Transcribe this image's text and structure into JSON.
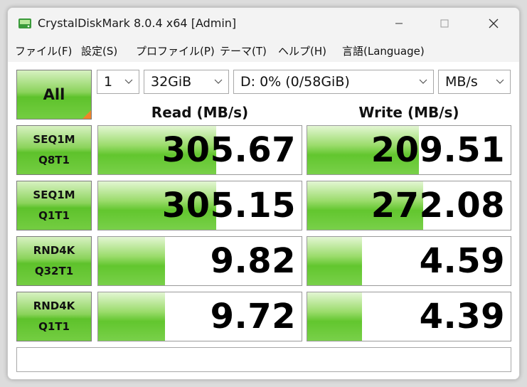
{
  "window": {
    "title": "CrystalDiskMark 8.0.4 x64 [Admin]",
    "app_icon": "disk-icon",
    "controls": [
      "minimize-icon",
      "maximize-icon",
      "close-icon"
    ]
  },
  "menu": {
    "items": [
      "ファイル(F)",
      "設定(S)",
      "プロファイル(P)",
      "テーマ(T)",
      "ヘルプ(H)",
      "言語(Language)"
    ]
  },
  "toolbar": {
    "all_label": "All",
    "count": "1",
    "size": "32GiB",
    "drive": "D: 0% (0/58GiB)",
    "unit": "MB/s"
  },
  "headers": {
    "read": "Read (MB/s)",
    "write": "Write (MB/s)"
  },
  "tests": [
    {
      "line1": "SEQ1M",
      "line2": "Q8T1",
      "read": "305.67",
      "write": "209.51",
      "read_fill": 0.58,
      "write_fill": 0.55
    },
    {
      "line1": "SEQ1M",
      "line2": "Q1T1",
      "read": "305.15",
      "write": "272.08",
      "read_fill": 0.58,
      "write_fill": 0.57
    },
    {
      "line1": "RND4K",
      "line2": "Q32T1",
      "read": "9.82",
      "write": "4.59",
      "read_fill": 0.33,
      "write_fill": 0.27
    },
    {
      "line1": "RND4K",
      "line2": "Q1T1",
      "read": "9.72",
      "write": "4.39",
      "read_fill": 0.33,
      "write_fill": 0.27
    }
  ],
  "comment": "",
  "colors": {
    "accent_green": "#5ec22b",
    "corner_orange": "#f0842a"
  }
}
